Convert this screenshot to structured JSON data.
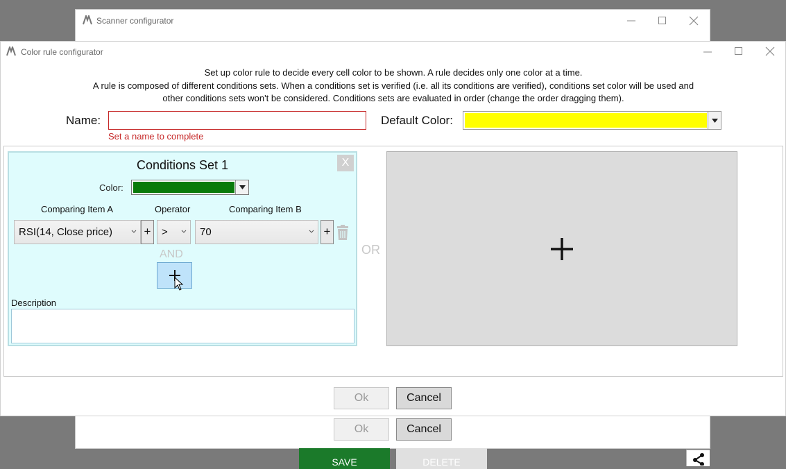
{
  "back_window": {
    "title": "Scanner configurator",
    "ok_label": "Ok",
    "cancel_label": "Cancel",
    "save_label": "SAVE",
    "delete_label": "DELETE"
  },
  "front_window": {
    "title": "Color rule configurator",
    "intro_line1": "Set up color rule to decide every cell color to be shown. A rule decides only one color at a time.",
    "intro_line2": "A rule is composed of different conditions sets. When a conditions set is verified (i.e. all its conditions are verified), conditions set color will be used and",
    "intro_line3": "other conditions sets won't be considered. Conditions sets are evaluated in order (change the order dragging them).",
    "name_label": "Name:",
    "name_value": "",
    "name_error": "Set a name to complete",
    "default_color_label": "Default Color:",
    "default_color": "#ffff00",
    "conditions_set": {
      "title": "Conditions Set 1",
      "remove_label": "X",
      "color_label": "Color:",
      "color": "#0a7a0a",
      "header_a": "Comparing Item A",
      "header_op": "Operator",
      "header_b": "Comparing Item B",
      "item_a": "RSI(14, Close price)",
      "operator": ">",
      "item_b": "70",
      "plus": "+",
      "and_label": "AND",
      "description_label": "Description",
      "description_value": ""
    },
    "or_label": "OR",
    "ok_label": "Ok",
    "cancel_label": "Cancel"
  }
}
